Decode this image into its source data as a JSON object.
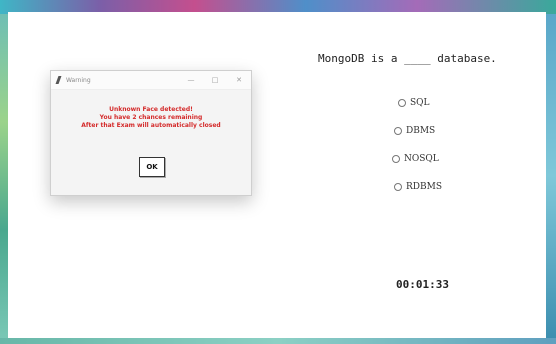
{
  "question": {
    "text": "MongoDB is a ____ database."
  },
  "options": [
    {
      "label": "SQL"
    },
    {
      "label": "DBMS"
    },
    {
      "label": "NOSQL"
    },
    {
      "label": "RDBMS"
    }
  ],
  "timer": {
    "text": "00:01:33"
  },
  "dialog": {
    "title": "Warning",
    "minimize": "—",
    "maximize": "□",
    "close": "✕",
    "message_lines": [
      "Unknown Face detected!",
      "You have 2 chances remaining",
      "After that Exam will automatically closed"
    ],
    "ok_label": "OK"
  },
  "colors": {
    "warning_text": "#d42a2a"
  }
}
